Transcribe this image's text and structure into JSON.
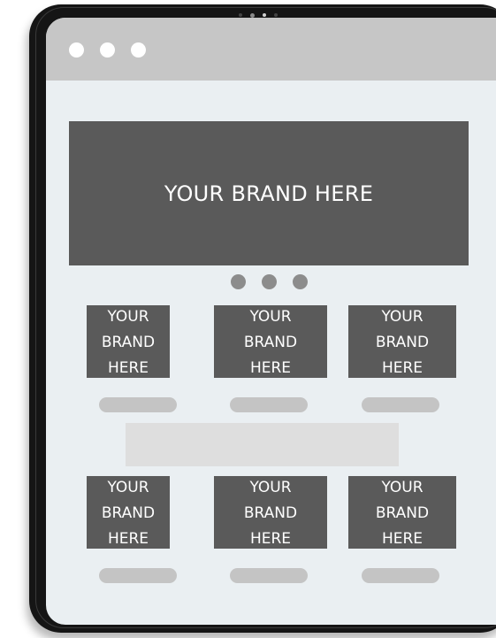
{
  "browser": {
    "window_controls": [
      "window-dot",
      "window-dot",
      "window-dot"
    ]
  },
  "hero": {
    "text": "YOUR BRAND HERE"
  },
  "carousel": {
    "pages": 3
  },
  "grid_row_1": [
    {
      "text": "YOUR BRAND HERE"
    },
    {
      "text": "YOUR BRAND HERE"
    },
    {
      "text": "YOUR BRAND HERE"
    }
  ],
  "grid_row_2": [
    {
      "text": "YOUR BRAND HERE"
    },
    {
      "text": "YOUR BRAND HERE"
    },
    {
      "text": "YOUR BRAND HERE"
    }
  ],
  "colors": {
    "bezel": "#151515",
    "screen": "#eaeff2",
    "browser_bar": "#c6c6c6",
    "placeholder_box": "#5a5a5a",
    "pager_dot": "#8c8c8c",
    "pill": "#c4c4c4",
    "banner": "#dedede"
  }
}
